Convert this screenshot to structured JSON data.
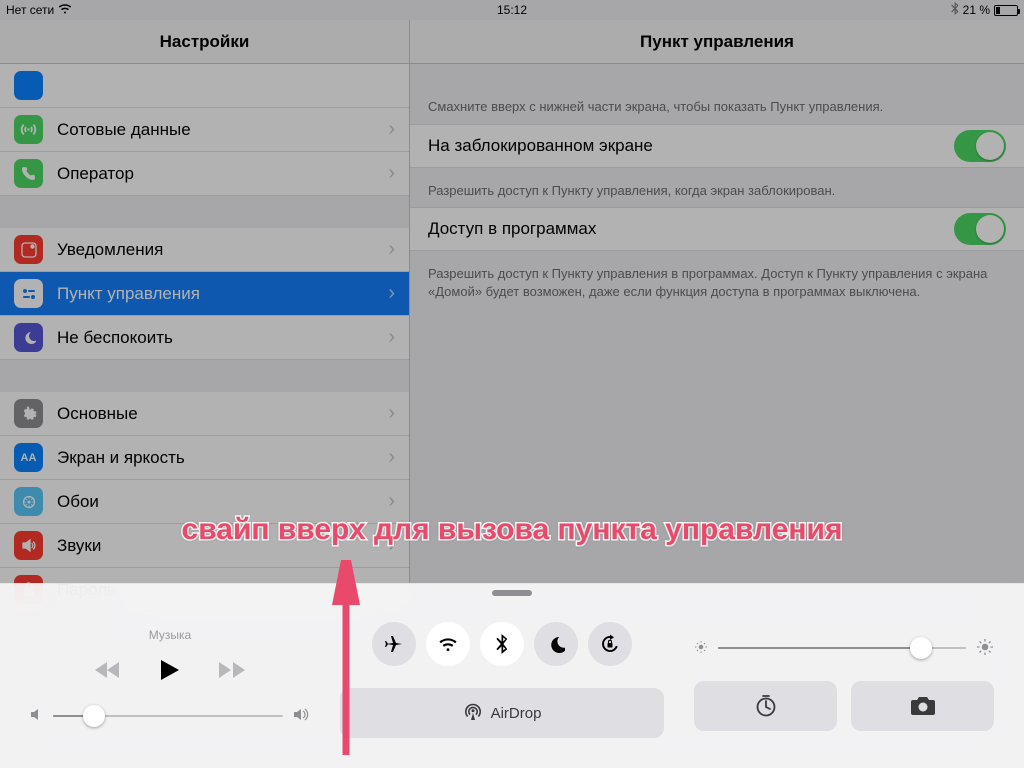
{
  "statusbar": {
    "network": "Нет сети",
    "time": "15:12",
    "battery": "21 %"
  },
  "sidebar": {
    "title": "Настройки",
    "groups": [
      [
        {
          "icon": "blue-placeholder",
          "label": ""
        },
        {
          "icon": "cellular",
          "label": "Сотовые данные"
        },
        {
          "icon": "carrier",
          "label": "Оператор"
        }
      ],
      [
        {
          "icon": "notifications",
          "label": "Уведомления"
        },
        {
          "icon": "control-center",
          "label": "Пункт управления",
          "selected": true
        },
        {
          "icon": "dnd",
          "label": "Не беспокоить"
        }
      ],
      [
        {
          "icon": "general",
          "label": "Основные"
        },
        {
          "icon": "display",
          "label": "Экран и яркость"
        },
        {
          "icon": "wallpaper",
          "label": "Обои"
        },
        {
          "icon": "sounds",
          "label": "Звуки"
        },
        {
          "icon": "passcode",
          "label": "Пароль"
        }
      ]
    ]
  },
  "detail": {
    "title": "Пункт управления",
    "hint1": "Смахните вверх с нижней части экрана, чтобы показать Пункт управления.",
    "row1": "На заблокированном экране",
    "hint2": "Разрешить доступ к Пункту управления, когда экран заблокирован.",
    "row2": "Доступ в программах",
    "hint3": "Разрешить доступ к Пункту управления в программах. Доступ к Пункту управления с экрана «Домой» будет возможен, даже если функция доступа в программах выключена."
  },
  "annotation": "свайп вверх для вызова пункта управления",
  "control_center": {
    "music_label": "Музыка",
    "airdrop_label": "AirDrop",
    "volume_pct": 18,
    "brightness_pct": 82,
    "toggles": {
      "airplane": false,
      "wifi": true,
      "bluetooth": true,
      "dnd": false,
      "lock": false
    }
  }
}
